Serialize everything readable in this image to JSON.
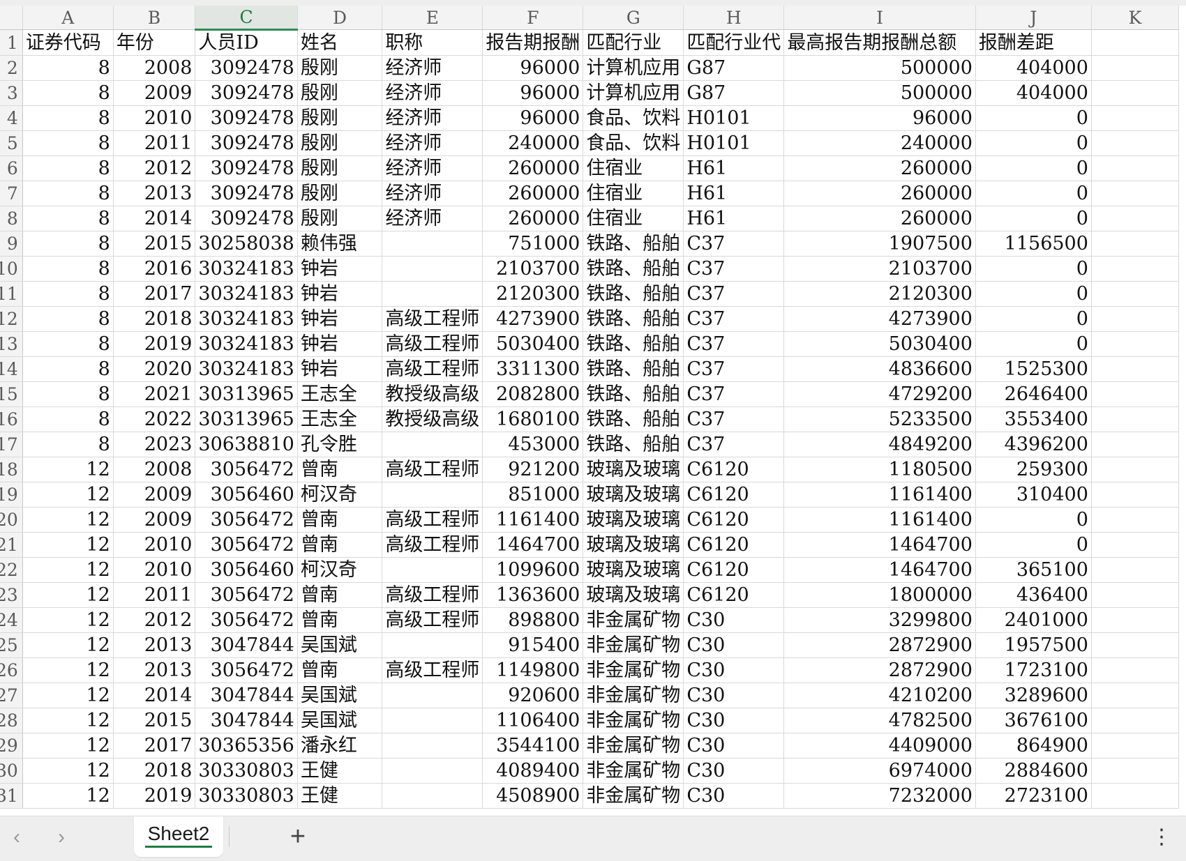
{
  "columns": [
    "A",
    "B",
    "C",
    "D",
    "E",
    "F",
    "G",
    "H",
    "I",
    "J",
    "K"
  ],
  "active_column": "C",
  "header_row": {
    "row": "1",
    "cells": [
      "证券代码",
      "年份",
      "人员ID",
      "姓名",
      "职称",
      "报告期报酬",
      "匹配行业",
      "匹配行业代",
      "最高报告期报酬总额",
      "报酬差距",
      ""
    ]
  },
  "rows": [
    {
      "row": "2",
      "cells": [
        "8",
        "2008",
        "3092478",
        "殷刚",
        "经济师",
        "96000",
        "计算机应用",
        "G87",
        "500000",
        "404000",
        ""
      ]
    },
    {
      "row": "3",
      "cells": [
        "8",
        "2009",
        "3092478",
        "殷刚",
        "经济师",
        "96000",
        "计算机应用",
        "G87",
        "500000",
        "404000",
        ""
      ]
    },
    {
      "row": "4",
      "cells": [
        "8",
        "2010",
        "3092478",
        "殷刚",
        "经济师",
        "96000",
        "食品、饮料",
        "H0101",
        "96000",
        "0",
        ""
      ]
    },
    {
      "row": "5",
      "cells": [
        "8",
        "2011",
        "3092478",
        "殷刚",
        "经济师",
        "240000",
        "食品、饮料",
        "H0101",
        "240000",
        "0",
        ""
      ]
    },
    {
      "row": "6",
      "cells": [
        "8",
        "2012",
        "3092478",
        "殷刚",
        "经济师",
        "260000",
        "住宿业",
        "H61",
        "260000",
        "0",
        ""
      ]
    },
    {
      "row": "7",
      "cells": [
        "8",
        "2013",
        "3092478",
        "殷刚",
        "经济师",
        "260000",
        "住宿业",
        "H61",
        "260000",
        "0",
        ""
      ]
    },
    {
      "row": "8",
      "cells": [
        "8",
        "2014",
        "3092478",
        "殷刚",
        "经济师",
        "260000",
        "住宿业",
        "H61",
        "260000",
        "0",
        ""
      ]
    },
    {
      "row": "9",
      "cells": [
        "8",
        "2015",
        "30258038",
        "赖伟强",
        "",
        "751000",
        "铁路、船舶",
        "C37",
        "1907500",
        "1156500",
        ""
      ]
    },
    {
      "row": "10",
      "cells": [
        "8",
        "2016",
        "30324183",
        "钟岩",
        "",
        "2103700",
        "铁路、船舶",
        "C37",
        "2103700",
        "0",
        ""
      ]
    },
    {
      "row": "11",
      "cells": [
        "8",
        "2017",
        "30324183",
        "钟岩",
        "",
        "2120300",
        "铁路、船舶",
        "C37",
        "2120300",
        "0",
        ""
      ]
    },
    {
      "row": "12",
      "cells": [
        "8",
        "2018",
        "30324183",
        "钟岩",
        "高级工程师",
        "4273900",
        "铁路、船舶",
        "C37",
        "4273900",
        "0",
        ""
      ]
    },
    {
      "row": "13",
      "cells": [
        "8",
        "2019",
        "30324183",
        "钟岩",
        "高级工程师",
        "5030400",
        "铁路、船舶",
        "C37",
        "5030400",
        "0",
        ""
      ]
    },
    {
      "row": "14",
      "cells": [
        "8",
        "2020",
        "30324183",
        "钟岩",
        "高级工程师",
        "3311300",
        "铁路、船舶",
        "C37",
        "4836600",
        "1525300",
        ""
      ]
    },
    {
      "row": "15",
      "cells": [
        "8",
        "2021",
        "30313965",
        "王志全",
        "教授级高级",
        "2082800",
        "铁路、船舶",
        "C37",
        "4729200",
        "2646400",
        ""
      ]
    },
    {
      "row": "16",
      "cells": [
        "8",
        "2022",
        "30313965",
        "王志全",
        "教授级高级",
        "1680100",
        "铁路、船舶",
        "C37",
        "5233500",
        "3553400",
        ""
      ]
    },
    {
      "row": "17",
      "cells": [
        "8",
        "2023",
        "30638810",
        "孔令胜",
        "",
        "453000",
        "铁路、船舶",
        "C37",
        "4849200",
        "4396200",
        ""
      ]
    },
    {
      "row": "18",
      "cells": [
        "12",
        "2008",
        "3056472",
        "曾南",
        "高级工程师",
        "921200",
        "玻璃及玻璃",
        "C6120",
        "1180500",
        "259300",
        ""
      ]
    },
    {
      "row": "19",
      "cells": [
        "12",
        "2009",
        "3056460",
        "柯汉奇",
        "",
        "851000",
        "玻璃及玻璃",
        "C6120",
        "1161400",
        "310400",
        ""
      ]
    },
    {
      "row": "20",
      "cells": [
        "12",
        "2009",
        "3056472",
        "曾南",
        "高级工程师",
        "1161400",
        "玻璃及玻璃",
        "C6120",
        "1161400",
        "0",
        ""
      ]
    },
    {
      "row": "21",
      "cells": [
        "12",
        "2010",
        "3056472",
        "曾南",
        "高级工程师",
        "1464700",
        "玻璃及玻璃",
        "C6120",
        "1464700",
        "0",
        ""
      ]
    },
    {
      "row": "22",
      "cells": [
        "12",
        "2010",
        "3056460",
        "柯汉奇",
        "",
        "1099600",
        "玻璃及玻璃",
        "C6120",
        "1464700",
        "365100",
        ""
      ]
    },
    {
      "row": "23",
      "cells": [
        "12",
        "2011",
        "3056472",
        "曾南",
        "高级工程师",
        "1363600",
        "玻璃及玻璃",
        "C6120",
        "1800000",
        "436400",
        ""
      ]
    },
    {
      "row": "24",
      "cells": [
        "12",
        "2012",
        "3056472",
        "曾南",
        "高级工程师",
        "898800",
        "非金属矿物",
        "C30",
        "3299800",
        "2401000",
        ""
      ]
    },
    {
      "row": "25",
      "cells": [
        "12",
        "2013",
        "3047844",
        "吴国斌",
        "",
        "915400",
        "非金属矿物",
        "C30",
        "2872900",
        "1957500",
        ""
      ]
    },
    {
      "row": "26",
      "cells": [
        "12",
        "2013",
        "3056472",
        "曾南",
        "高级工程师",
        "1149800",
        "非金属矿物",
        "C30",
        "2872900",
        "1723100",
        ""
      ]
    },
    {
      "row": "27",
      "cells": [
        "12",
        "2014",
        "3047844",
        "吴国斌",
        "",
        "920600",
        "非金属矿物",
        "C30",
        "4210200",
        "3289600",
        ""
      ]
    },
    {
      "row": "28",
      "cells": [
        "12",
        "2015",
        "3047844",
        "吴国斌",
        "",
        "1106400",
        "非金属矿物",
        "C30",
        "4782500",
        "3676100",
        ""
      ]
    },
    {
      "row": "29",
      "cells": [
        "12",
        "2017",
        "30365356",
        "潘永红",
        "",
        "3544100",
        "非金属矿物",
        "C30",
        "4409000",
        "864900",
        ""
      ]
    },
    {
      "row": "30",
      "cells": [
        "12",
        "2018",
        "30330803",
        "王健",
        "",
        "4089400",
        "非金属矿物",
        "C30",
        "6974000",
        "2884600",
        ""
      ]
    },
    {
      "row": "31",
      "cells": [
        "12",
        "2019",
        "30330803",
        "王健",
        "",
        "4508900",
        "非金属矿物",
        "C30",
        "7232000",
        "2723100",
        ""
      ]
    }
  ],
  "sheet_tabs": {
    "active_label": "Sheet2",
    "prev_icon": "‹",
    "next_icon": "›",
    "add_icon": "+",
    "menu_icon": "⋮"
  }
}
